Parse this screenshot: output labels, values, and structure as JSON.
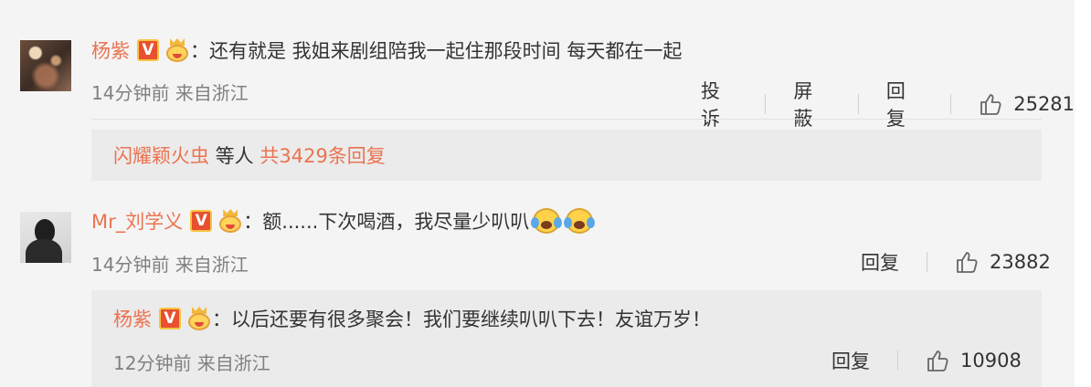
{
  "comments": [
    {
      "username": "杨紫",
      "verified": "V",
      "text": "：还有就是 我姐来剧组陪我一起住那段时间 每天都在一起",
      "time": "14分钟前 来自浙江",
      "actions": {
        "report": "投诉",
        "block": "屏蔽",
        "reply": "回复"
      },
      "likes": "25281",
      "replies_summary": {
        "user": "闪耀颖火虫",
        "middle": " 等人 ",
        "count": "共3429条回复"
      }
    },
    {
      "username": "Mr_刘学义",
      "verified": "V",
      "text": "：额......下次喝酒，我尽量少叭叭",
      "time": "14分钟前 来自浙江",
      "actions": {
        "reply": "回复"
      },
      "likes": "23882",
      "reply": {
        "username": "杨紫",
        "verified": "V",
        "text": "：以后还要有很多聚会！我们要继续叭叭下去！友谊万岁！",
        "time": "12分钟前 来自浙江",
        "actions": {
          "reply": "回复"
        },
        "likes": "10908"
      }
    }
  ],
  "colors": {
    "username": "#eb7350",
    "text": "#333333",
    "meta": "#808080",
    "background": "#f4f4f4",
    "reply_box": "#ebebeb"
  },
  "icons": [
    "avatar",
    "verified-v-icon",
    "fan-crown-icon",
    "thumbs-up-icon",
    "crying-laugh-emoji"
  ]
}
